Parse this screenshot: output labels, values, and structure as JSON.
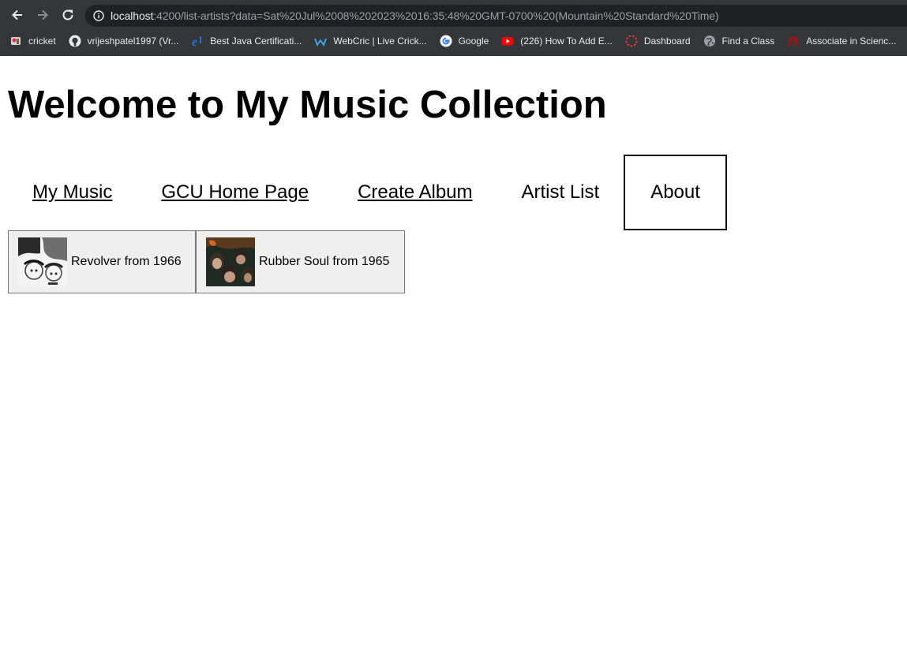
{
  "browser": {
    "url_host": "localhost",
    "url_rest": ":4200/list-artists?data=Sat%20Jul%2008%202023%2016:35:48%20GMT-0700%20(Mountain%20Standard%20Time)",
    "bookmarks": [
      {
        "label": "cricket",
        "icon": "cricket-icon"
      },
      {
        "label": "vrijeshpatel1997 (Vr...",
        "icon": "github-icon"
      },
      {
        "label": "Best Java Certificati...",
        "icon": "enthuware-icon"
      },
      {
        "label": "WebCric | Live Crick...",
        "icon": "webcric-icon"
      },
      {
        "label": "Google",
        "icon": "google-icon"
      },
      {
        "label": "(226) How To Add E...",
        "icon": "youtube-icon"
      },
      {
        "label": "Dashboard",
        "icon": "dashboard-icon"
      },
      {
        "label": "Find a Class",
        "icon": "globe-icon"
      },
      {
        "label": "Associate in Scienc...",
        "icon": "college-icon"
      }
    ]
  },
  "page": {
    "title": "Welcome to My Music Collection",
    "nav": [
      {
        "label": "My Music"
      },
      {
        "label": "GCU Home Page"
      },
      {
        "label": "Create Album"
      },
      {
        "label": "Artist List"
      },
      {
        "label": "About"
      }
    ],
    "albums": [
      {
        "label": "Revolver from 1966"
      },
      {
        "label": "Rubber Soul from 1965"
      }
    ]
  }
}
